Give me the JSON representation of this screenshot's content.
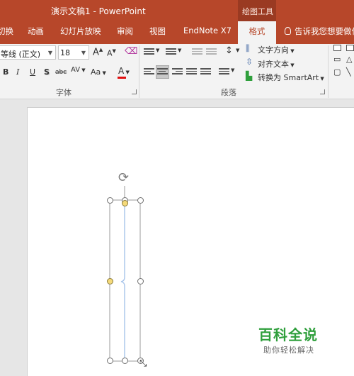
{
  "window": {
    "title": "演示文稿1 - PowerPoint",
    "context_group": "绘图工具"
  },
  "tabs": [
    {
      "label": "切换"
    },
    {
      "label": "动画"
    },
    {
      "label": "幻灯片放映"
    },
    {
      "label": "审阅"
    },
    {
      "label": "视图"
    },
    {
      "label": "EndNote X7"
    },
    {
      "label": "格式",
      "active": true
    }
  ],
  "tell_me": "告诉我您想要做什么",
  "font_group": {
    "label": "字体",
    "font_name": "等线 (正文)",
    "font_size": "18",
    "buttons": {
      "bold": "B",
      "italic": "I",
      "underline": "U",
      "shadow": "S",
      "strike": "abc",
      "spacing": "AV",
      "case": "Aa",
      "font_color": "A",
      "grow": "A",
      "shrink": "A"
    },
    "font_color_hex": "#e01010"
  },
  "paragraph_group": {
    "label": "段落",
    "text_direction": "文字方向",
    "align_text": "对齐文本",
    "convert_smartart": "转换为 SmartArt"
  },
  "watermark": {
    "title": "百科全说",
    "subtitle": "助你轻松解决"
  },
  "colors": {
    "accent": "#b7472a",
    "selection_line": "#a7c4ea"
  }
}
